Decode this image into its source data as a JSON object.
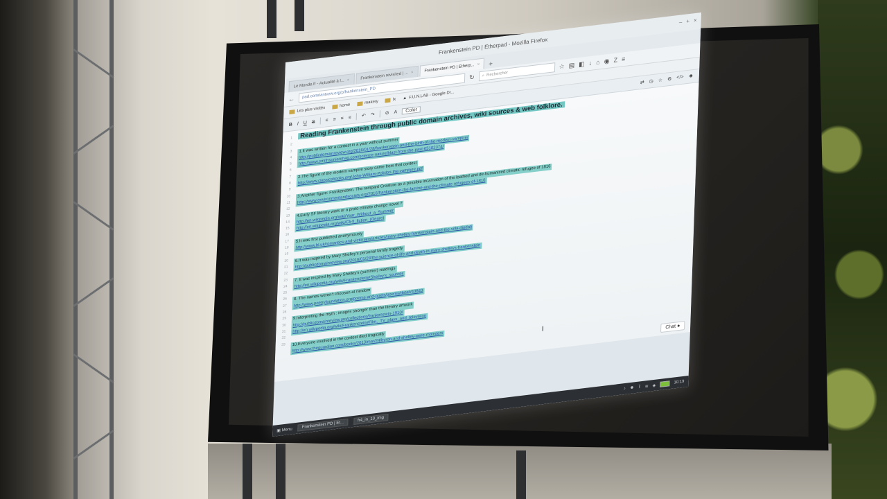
{
  "window": {
    "title": "Frankenstein PD | Etherpad - Mozilla Firefox",
    "controls": [
      "–",
      "+",
      "×"
    ]
  },
  "tabs": [
    {
      "label": "Le Monde.fr - Actualité à l...",
      "active": false
    },
    {
      "label": "Frankenstein revisited | ...",
      "active": false
    },
    {
      "label": "Frankenstein PD | Etherp...",
      "active": true
    }
  ],
  "navbar": {
    "url": "pad.constantvzw.org/p/frankenstein_PD",
    "search_placeholder": "Rechercher"
  },
  "bookmarks": [
    {
      "label": "Les plus visités",
      "icon": "folder-icon"
    },
    {
      "label": "home",
      "icon": "folder-icon"
    },
    {
      "label": "makery",
      "icon": "folder-icon"
    },
    {
      "label": "lx",
      "icon": "folder-icon"
    },
    {
      "label": "F.U.N.LAB - Google Dr...",
      "icon": "drive-icon"
    }
  ],
  "pad_toolbar": {
    "buttons": [
      "B",
      "I",
      "U",
      "S",
      "≡",
      "≡",
      "≡",
      "≡",
      "↶",
      "↷",
      "⊘",
      "A"
    ],
    "color_label": "Color"
  },
  "pad": {
    "title": "Reading Frankenstein through public domain archives, wiki sources & web folklore.",
    "lines": [
      {
        "n": "1",
        "text": "",
        "type": "blank"
      },
      {
        "n": "2",
        "text": "1.It was written for a contest in a year without summer",
        "type": "text"
      },
      {
        "n": "3",
        "text": "http://publicdomainreview.org/2016/01/28/frankenstein-and-the-birth-of-the-modern-vampire/",
        "type": "link"
      },
      {
        "n": "4",
        "text": "http://www.smithsonianmag.com/science-nature/blast-from-the-past-65102374/",
        "type": "link"
      },
      {
        "n": "5",
        "text": "",
        "type": "blank"
      },
      {
        "n": "6",
        "text": "2.The figure of the modern vampire story came from that contest",
        "type": "text"
      },
      {
        "n": "7",
        "text": "http://www.classicsbooks.org/John-William-Polidori-the-vampyre.pdf",
        "type": "link"
      },
      {
        "n": "8",
        "text": "",
        "type": "blank"
      },
      {
        "n": "9",
        "text": "3.Another figure: Frankenstein. The rampant Creature as a possible incarnation of the loathed and de-humanized climatic refugee of 1816",
        "type": "text"
      },
      {
        "n": "10",
        "text": "http://www.environmentandsociety.org/2016/frankenstein-the-famine-and-the-climate-refugees-of-1816",
        "type": "link"
      },
      {
        "n": "11",
        "text": "",
        "type": "blank"
      },
      {
        "n": "12",
        "text": "4.Early SF literary work or a proto climate change novel ?",
        "type": "text"
      },
      {
        "n": "13",
        "text": "http://en.wikipedia.org/wiki/Year_Without_a_Summer",
        "type": "link"
      },
      {
        "n": "14",
        "text": "http://en.wikipedia.org/wiki/Cli-fi_fiction_(Genre)",
        "type": "link"
      },
      {
        "n": "15",
        "text": "",
        "type": "blank"
      },
      {
        "n": "16",
        "text": "5.It was first published anonymously",
        "type": "text"
      },
      {
        "n": "17",
        "text": "http://www.bl.uk/romantics-and-victorians/articles/mary-shelley-frankenstein-and-the-villa-diodati",
        "type": "link"
      },
      {
        "n": "18",
        "text": "",
        "type": "blank"
      },
      {
        "n": "19",
        "text": "6.It was inspired by Mary Shelley's personal family tragedy",
        "type": "text"
      },
      {
        "n": "20",
        "text": "http://publicdomainreview.org/2016/01/28/the-science-of-life-and-death-in-mary-shelleys-frankenstein",
        "type": "link"
      },
      {
        "n": "21",
        "text": "",
        "type": "blank"
      },
      {
        "n": "22",
        "text": "7. It was inspired by Mary Shelley's (summer) readings",
        "type": "text"
      },
      {
        "n": "23",
        "text": "http://en.wikipedia.org/wiki/Frankenstein#Shelley's_sources",
        "type": "link"
      },
      {
        "n": "24",
        "text": "",
        "type": "blank"
      },
      {
        "n": "25",
        "text": "8. The names weren't choosen at random",
        "type": "text"
      },
      {
        "n": "26",
        "text": "http://www.poetryfoundation.org/poems-and-poets/poems/detail/43843",
        "type": "link"
      },
      {
        "n": "27",
        "text": "",
        "type": "blank"
      },
      {
        "n": "28",
        "text": "9.Interpreting the myth : images stronger than the literary artwork",
        "type": "text"
      },
      {
        "n": "29",
        "text": "http://publicdomainreview.org/collections/frankenstein-1910/",
        "type": "link"
      },
      {
        "n": "30",
        "text": "http://en.wikipedia.org/wiki/Frankenstein#Film,_TV_plays_and_television",
        "type": "link"
      },
      {
        "n": "31",
        "text": "",
        "type": "blank"
      },
      {
        "n": "32",
        "text": "10.Everyone involved in the contest died tragically",
        "type": "text"
      },
      {
        "n": "33",
        "text": "http://www.theguardian.com/books/2013/mar/24/byron-and-shelley-were-monsters",
        "type": "link"
      }
    ]
  },
  "chat_label": "Chat",
  "taskbar": {
    "menu_label": "Menu",
    "tasks": [
      "Frankenstein PD | Et...",
      "fr4_in_10_img"
    ],
    "clock": "10:19"
  },
  "colors": {
    "highlight": "#84cfc9",
    "link": "#2a55a8",
    "taskbar": "#2c2f33"
  }
}
